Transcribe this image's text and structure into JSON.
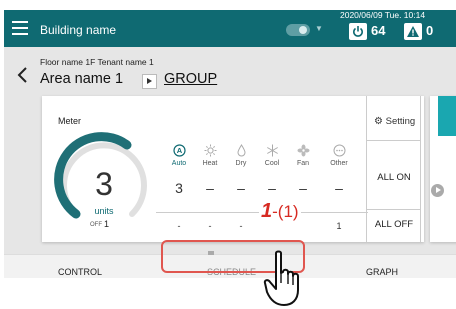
{
  "header": {
    "building_name": "Building name",
    "datetime": "2020/06/09 Tue. 10:14",
    "power_count": "64",
    "alert_count": "0"
  },
  "location": {
    "floor_tenant": "Floor name 1F Tenant name 1",
    "area_name": "Area name 1",
    "group_link": "GROUP"
  },
  "meter": {
    "label": "Meter",
    "value": "3",
    "units": "units",
    "off_label": "OFF",
    "off_value": "1"
  },
  "modes": [
    {
      "label": "Auto",
      "icon": "auto-icon",
      "count": "3",
      "bottom": "-"
    },
    {
      "label": "Heat",
      "icon": "heat-icon",
      "count": "–",
      "bottom": "-"
    },
    {
      "label": "Dry",
      "icon": "dry-icon",
      "count": "–",
      "bottom": "-"
    },
    {
      "label": "Cool",
      "icon": "cool-icon",
      "count": "–",
      "bottom": "-"
    },
    {
      "label": "Fan",
      "icon": "fan-icon",
      "count": "–",
      "bottom": "-"
    },
    {
      "label": "Other",
      "icon": "other-icon",
      "count": "–",
      "bottom": "1"
    }
  ],
  "controls": {
    "setting": "Setting",
    "all_on": "ALL ON",
    "all_off": "ALL OFF"
  },
  "nav": {
    "control": "CONTROL",
    "schedule": "SCHEDULE",
    "graph": "GRAPH"
  },
  "annotation": {
    "step": "1",
    "sub": "-(1)"
  },
  "colors": {
    "accent": "#0f6a72",
    "highlight": "#e0564f",
    "annotation": "#d72a22"
  }
}
